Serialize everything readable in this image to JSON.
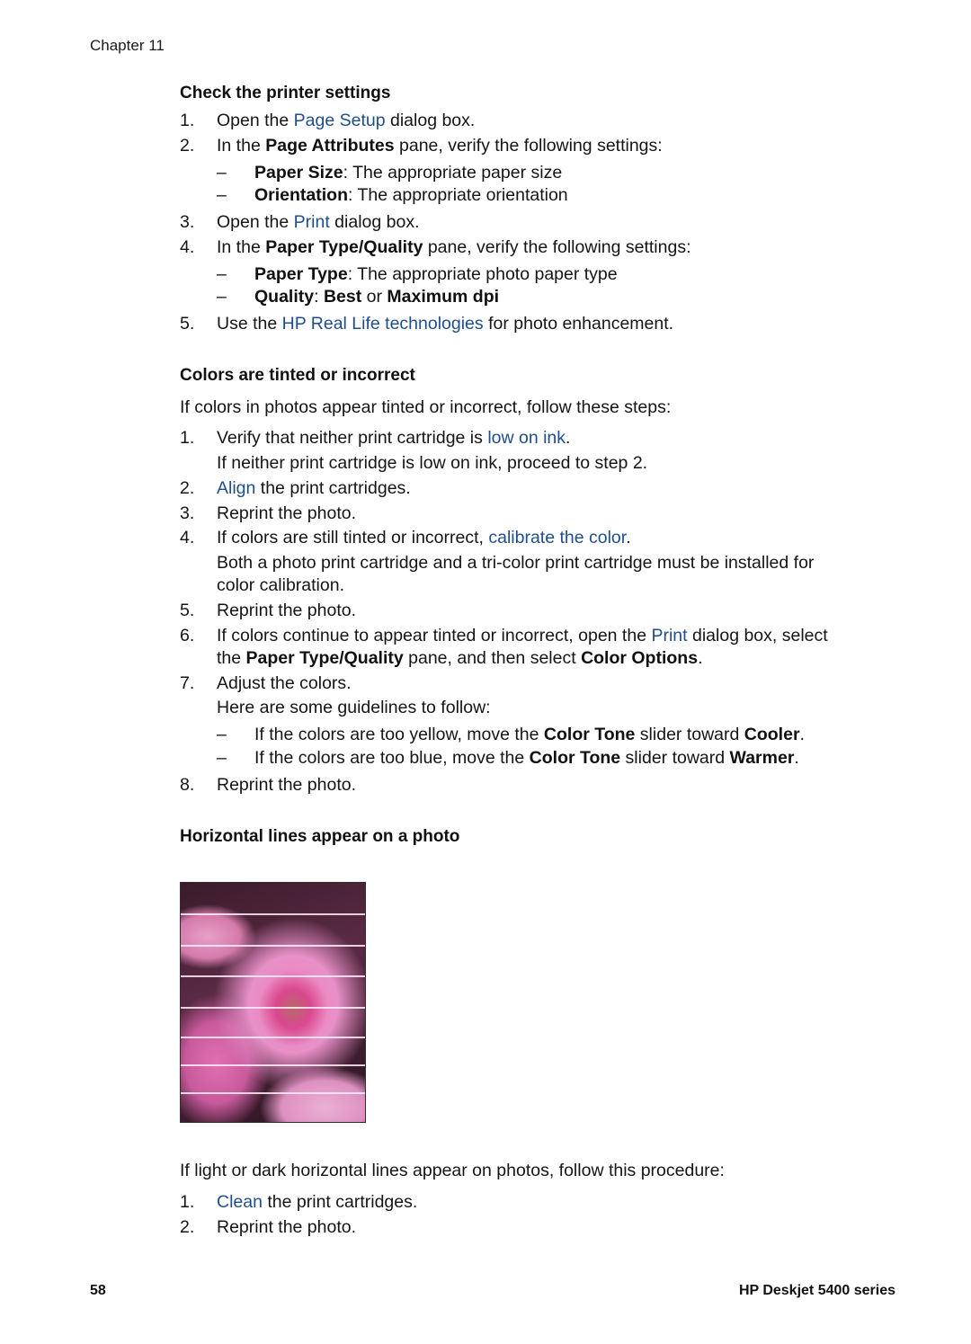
{
  "header": {
    "chapter": "Chapter 11"
  },
  "section1": {
    "title": "Check the printer settings",
    "step1": {
      "num": "1.",
      "pre": "Open the ",
      "link": "Page Setup",
      "post": " dialog box."
    },
    "step2": {
      "num": "2.",
      "pre": "In the ",
      "bold": "Page Attributes",
      "post": " pane, verify the following settings:"
    },
    "step2_bullets": [
      {
        "dash": "–",
        "bold": "Paper Size",
        "text": ": The appropriate paper size"
      },
      {
        "dash": "–",
        "bold": "Orientation",
        "text": ": The appropriate orientation"
      }
    ],
    "step3": {
      "num": "3.",
      "pre": "Open the ",
      "link": "Print",
      "post": " dialog box."
    },
    "step4": {
      "num": "4.",
      "pre": "In the ",
      "bold": "Paper Type/Quality",
      "post": " pane, verify the following settings:"
    },
    "step4_bullets": [
      {
        "dash": "–",
        "bold": "Paper Type",
        "text": ": The appropriate photo paper type"
      },
      {
        "dash": "–",
        "bold": "Quality",
        "sep": ": ",
        "bold2": "Best",
        "mid": " or ",
        "bold3": "Maximum dpi"
      }
    ],
    "step5": {
      "num": "5.",
      "pre": "Use the ",
      "link": "HP Real Life technologies",
      "post": " for photo enhancement."
    }
  },
  "section2": {
    "title": "Colors are tinted or incorrect",
    "intro": "If colors in photos appear tinted or incorrect, follow these steps:",
    "step1": {
      "num": "1.",
      "pre": "Verify that neither print cartridge is ",
      "link": "low on ink",
      "post": "."
    },
    "step1_note": "If neither print cartridge is low on ink, proceed to step 2.",
    "step2": {
      "num": "2.",
      "link": "Align",
      "post": " the print cartridges."
    },
    "step3": {
      "num": "3.",
      "text": "Reprint the photo."
    },
    "step4": {
      "num": "4.",
      "pre": "If colors are still tinted or incorrect, ",
      "link": "calibrate the color",
      "post": "."
    },
    "step4_note_line1": "Both a photo print cartridge and a tri-color print cartridge must be installed for",
    "step4_note_line2": "color calibration.",
    "step5": {
      "num": "5.",
      "text": "Reprint the photo."
    },
    "step6": {
      "num": "6.",
      "pre": "If colors continue to appear tinted or incorrect, open the ",
      "link": "Print",
      "post": " dialog box, select"
    },
    "step6_line2": {
      "pre": "the ",
      "bold": "Paper Type/Quality",
      "mid": " pane, and then select ",
      "bold2": "Color Options",
      "post": "."
    },
    "step7": {
      "num": "7.",
      "text": "Adjust the colors."
    },
    "step7_note": "Here are some guidelines to follow:",
    "step7_bullets": [
      {
        "dash": "–",
        "pre": "If the colors are too yellow, move the ",
        "bold": "Color Tone",
        "mid": " slider toward ",
        "bold2": "Cooler",
        "post": "."
      },
      {
        "dash": "–",
        "pre": "If the colors are too blue, move the ",
        "bold": "Color Tone",
        "mid": " slider toward ",
        "bold2": "Warmer",
        "post": "."
      }
    ],
    "step8": {
      "num": "8.",
      "text": "Reprint the photo."
    }
  },
  "section3": {
    "title": "Horizontal lines appear on a photo",
    "image_alt": "Pink flower photo with horizontal light lines",
    "intro": "If light or dark horizontal lines appear on photos, follow this procedure:",
    "step1": {
      "num": "1.",
      "link": "Clean",
      "post": " the print cartridges."
    },
    "step2": {
      "num": "2.",
      "text": "Reprint the photo."
    }
  },
  "footer": {
    "page_number": "58",
    "product": "HP Deskjet 5400 series"
  },
  "colors": {
    "link": "#1f4e8c",
    "text": "#111111"
  }
}
